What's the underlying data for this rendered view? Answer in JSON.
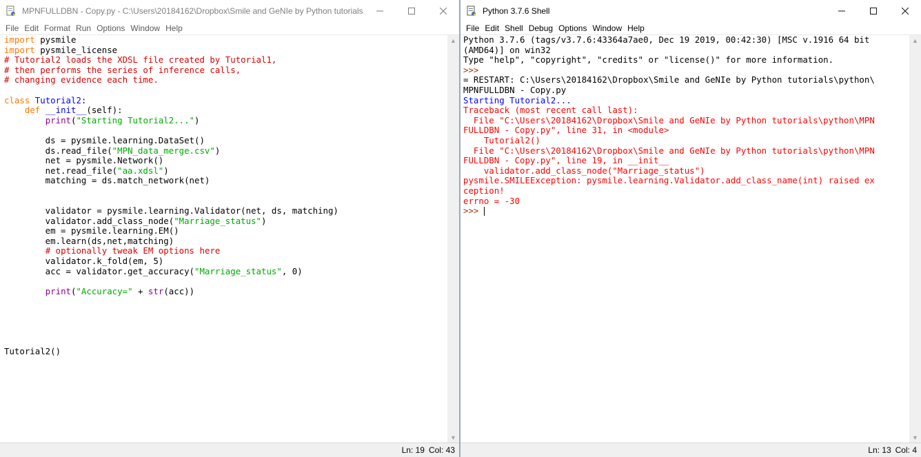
{
  "editor": {
    "title": "MPNFULLDBN - Copy.py - C:\\Users\\20184162\\Dropbox\\Smile and GeNIe by Python tutorials...",
    "menu": [
      "File",
      "Edit",
      "Format",
      "Run",
      "Options",
      "Window",
      "Help"
    ],
    "status": {
      "line": "Ln: 19",
      "col": "Col: 43"
    },
    "code_lines": [
      [
        {
          "t": "import",
          "c": "kw"
        },
        {
          "t": " pysmile"
        }
      ],
      [
        {
          "t": "import",
          "c": "kw"
        },
        {
          "t": " pysmile_license"
        }
      ],
      [
        {
          "t": "# Tutorial2 loads the XDSL file created by Tutorial1,",
          "c": "cmt"
        }
      ],
      [
        {
          "t": "# then performs the series of inference calls,",
          "c": "cmt"
        }
      ],
      [
        {
          "t": "# changing evidence each time.",
          "c": "cmt"
        }
      ],
      [
        {
          "t": ""
        }
      ],
      [
        {
          "t": "class",
          "c": "kw"
        },
        {
          "t": " "
        },
        {
          "t": "Tutorial2",
          "c": "def"
        },
        {
          "t": ":"
        }
      ],
      [
        {
          "t": "    "
        },
        {
          "t": "def",
          "c": "kw"
        },
        {
          "t": " "
        },
        {
          "t": "__init__",
          "c": "def"
        },
        {
          "t": "(self):"
        }
      ],
      [
        {
          "t": "        "
        },
        {
          "t": "print",
          "c": "bi"
        },
        {
          "t": "("
        },
        {
          "t": "\"Starting Tutorial2...\"",
          "c": "str"
        },
        {
          "t": ")"
        }
      ],
      [
        {
          "t": ""
        }
      ],
      [
        {
          "t": "        ds = pysmile.learning.DataSet()"
        }
      ],
      [
        {
          "t": "        ds.read_file("
        },
        {
          "t": "\"MPN_data_merge.csv\"",
          "c": "str"
        },
        {
          "t": ")"
        }
      ],
      [
        {
          "t": "        net = pysmile.Network()"
        }
      ],
      [
        {
          "t": "        net.read_file("
        },
        {
          "t": "\"aa.xdsl\"",
          "c": "str"
        },
        {
          "t": ")"
        }
      ],
      [
        {
          "t": "        matching = ds.match_network(net)"
        }
      ],
      [
        {
          "t": ""
        }
      ],
      [
        {
          "t": ""
        }
      ],
      [
        {
          "t": "        validator = pysmile.learning.Validator(net, ds, matching)"
        }
      ],
      [
        {
          "t": "        validator.add_class_node("
        },
        {
          "t": "\"Marriage_status\"",
          "c": "str"
        },
        {
          "t": ")"
        }
      ],
      [
        {
          "t": "        em = pysmile.learning.EM()"
        }
      ],
      [
        {
          "t": "        em.learn(ds,net,matching)"
        }
      ],
      [
        {
          "t": "        "
        },
        {
          "t": "# optionally tweak EM options here",
          "c": "cmt"
        }
      ],
      [
        {
          "t": "        validator.k_fold(em, 5)"
        }
      ],
      [
        {
          "t": "        acc = validator.get_accuracy("
        },
        {
          "t": "\"Marriage_status\"",
          "c": "str"
        },
        {
          "t": ", 0)"
        }
      ],
      [
        {
          "t": ""
        }
      ],
      [
        {
          "t": "        "
        },
        {
          "t": "print",
          "c": "bi"
        },
        {
          "t": "("
        },
        {
          "t": "\"Accuracy=\"",
          "c": "str"
        },
        {
          "t": " + "
        },
        {
          "t": "str",
          "c": "bi"
        },
        {
          "t": "(acc))"
        }
      ],
      [
        {
          "t": ""
        }
      ],
      [
        {
          "t": ""
        }
      ],
      [
        {
          "t": ""
        }
      ],
      [
        {
          "t": ""
        }
      ],
      [
        {
          "t": ""
        }
      ],
      [
        {
          "t": "Tutorial2()"
        }
      ]
    ]
  },
  "shell": {
    "title": "Python 3.7.6 Shell",
    "menu": [
      "File",
      "Edit",
      "Shell",
      "Debug",
      "Options",
      "Window",
      "Help"
    ],
    "status": {
      "line": "Ln: 13",
      "col": "Col: 4"
    },
    "lines": [
      [
        {
          "t": "Python 3.7.6 (tags/v3.7.6:43364a7ae0, Dec 19 2019, 00:42:30) [MSC v.1916 64 bit"
        }
      ],
      [
        {
          "t": "(AMD64)] on win32"
        }
      ],
      [
        {
          "t": "Type \"help\", \"copyright\", \"credits\" or \"license()\" for more information."
        }
      ],
      [
        {
          "t": ">>> ",
          "c": "prompt"
        }
      ],
      [
        {
          "t": "= RESTART: C:\\Users\\20184162\\Dropbox\\Smile and GeNIe by Python tutorials\\python\\"
        }
      ],
      [
        {
          "t": "MPNFULLDBN - Copy.py"
        }
      ],
      [
        {
          "t": "Starting Tutorial2...",
          "c": "out"
        }
      ],
      [
        {
          "t": "Traceback (most recent call last):",
          "c": "err"
        }
      ],
      [
        {
          "t": "  File \"C:\\Users\\20184162\\Dropbox\\Smile and GeNIe by Python tutorials\\python\\MPN",
          "c": "err"
        }
      ],
      [
        {
          "t": "FULLDBN - Copy.py\", line 31, in <module>",
          "c": "err"
        }
      ],
      [
        {
          "t": "    Tutorial2()",
          "c": "err"
        }
      ],
      [
        {
          "t": "  File \"C:\\Users\\20184162\\Dropbox\\Smile and GeNIe by Python tutorials\\python\\MPN",
          "c": "err"
        }
      ],
      [
        {
          "t": "FULLDBN - Copy.py\", line 19, in __init__",
          "c": "err"
        }
      ],
      [
        {
          "t": "    validator.add_class_node(\"Marriage_status\")",
          "c": "err"
        }
      ],
      [
        {
          "t": "pysmile.SMILEException: pysmile.learning.Validator.add_class_name(int) raised ex",
          "c": "err"
        }
      ],
      [
        {
          "t": "ception!",
          "c": "err"
        }
      ],
      [
        {
          "t": "errno = -30",
          "c": "err"
        }
      ],
      [
        {
          "t": ">>> ",
          "c": "prompt"
        }
      ]
    ]
  }
}
